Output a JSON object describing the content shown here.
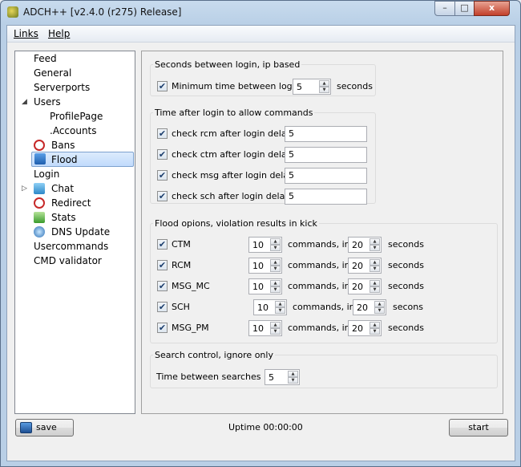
{
  "window": {
    "title": "ADCH++ [v2.4.0 (r275) Release]",
    "min_glyph": "–",
    "max_glyph": "□",
    "close_glyph": "x"
  },
  "menu": {
    "links": "Links",
    "help": "Help"
  },
  "tree": [
    {
      "label": "Feed"
    },
    {
      "label": "General"
    },
    {
      "label": "Serverports"
    },
    {
      "label": "Users"
    },
    {
      "label": "ProfilePage"
    },
    {
      "label": ".Accounts"
    },
    {
      "label": "Bans"
    },
    {
      "label": "Flood"
    },
    {
      "label": "Login"
    },
    {
      "label": "Chat"
    },
    {
      "label": "Redirect"
    },
    {
      "label": "Stats"
    },
    {
      "label": "DNS Update"
    },
    {
      "label": "Usercommands"
    },
    {
      "label": "CMD validator"
    }
  ],
  "login_group": {
    "title": "Seconds between login, ip based",
    "checkbox_label": "Minimum time between logins",
    "value": "5",
    "unit": "seconds"
  },
  "commands_group": {
    "title": "Time after login to allow commands",
    "rows": [
      {
        "label": "check rcm after login delay",
        "value": "5"
      },
      {
        "label": "check ctm after login delay",
        "value": "5"
      },
      {
        "label": "check msg after login delay",
        "value": "5"
      },
      {
        "label": "check sch after login delay",
        "value": "5"
      }
    ]
  },
  "flood_group": {
    "title": "Flood opions, violation results in kick",
    "rows": [
      {
        "label": "CTM",
        "count": "10",
        "mid": "commands, in",
        "secs": "20",
        "unit": "seconds"
      },
      {
        "label": "RCM",
        "count": "10",
        "mid": "commands, in",
        "secs": "20",
        "unit": "seconds"
      },
      {
        "label": "MSG_MC",
        "count": "10",
        "mid": "commands, in",
        "secs": "20",
        "unit": "seconds"
      },
      {
        "label": "SCH",
        "count": "10",
        "mid": "commands, in",
        "secs": "20",
        "unit": "secons"
      },
      {
        "label": "MSG_PM",
        "count": "10",
        "mid": "commands, in",
        "secs": "20",
        "unit": "seconds"
      }
    ]
  },
  "search_group": {
    "title": "Search control, ignore only",
    "label": "Time between searches (s)",
    "value": "5"
  },
  "footer": {
    "save": "save",
    "uptime": "Uptime 00:00:00",
    "start": "start"
  },
  "glyphs": {
    "check": "✔",
    "up": "▲",
    "down": "▼",
    "expanded": "◢",
    "collapsed": "▷"
  }
}
